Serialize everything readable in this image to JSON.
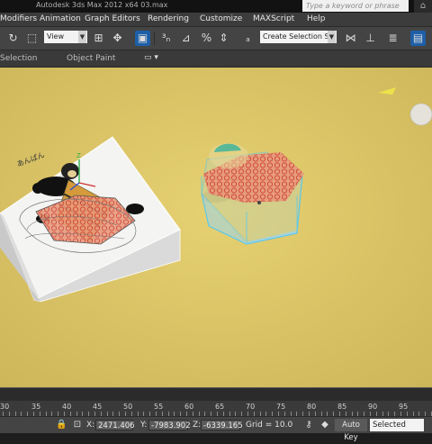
{
  "titlebar": {
    "title": "Autodesk 3ds Max  2012 x64        03.max",
    "search_placeholder": "Type a keyword or phrase"
  },
  "menu": {
    "items": [
      "Modifiers",
      "Animation",
      "Graph Editors",
      "Rendering",
      "Customize",
      "MAXScript",
      "Help"
    ]
  },
  "toolbar": {
    "coord_system": "View",
    "selection_set_placeholder": "Create Selection Se",
    "icons": [
      "redo-icon",
      "select-icon",
      "move-icon",
      "rotate-icon",
      "scale-icon",
      "pivot-icon",
      "snap-3d-icon",
      "angle-snap-icon",
      "percent-snap-icon",
      "spinner-snap-icon",
      "edit-named-selection-icon",
      "mirror-icon",
      "align-icon",
      "layer-manager-icon",
      "render-icon"
    ]
  },
  "ribbon": {
    "tabs": [
      "Selection",
      "Object Paint"
    ]
  },
  "timeline": {
    "ticks": [
      "30",
      "35",
      "40",
      "45",
      "50",
      "55",
      "60",
      "65",
      "70",
      "75",
      "80",
      "85",
      "90",
      "95"
    ]
  },
  "status": {
    "x_label": "X:",
    "x_value": "2471.406",
    "y_label": "Y:",
    "y_value": "-7983.902",
    "z_label": "Z:",
    "z_value": "-6339.165",
    "grid": "Grid = 10.0",
    "autokey": "Auto Key",
    "key_mode": "Selected"
  },
  "colors": {
    "viewport_bg": "#d8c263",
    "selection_accent": "#5ec8e8",
    "active_button": "#1e5fa8"
  }
}
